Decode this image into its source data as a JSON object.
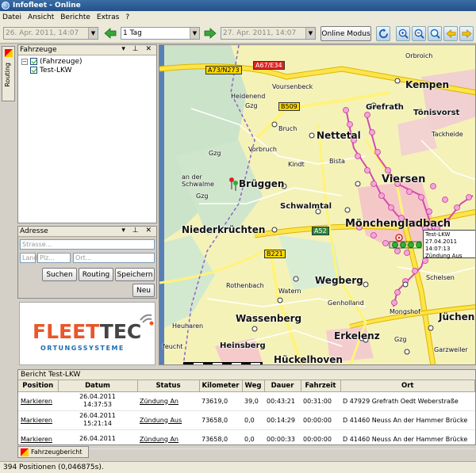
{
  "window": {
    "title": "Infofleet - Online"
  },
  "menu": [
    "Datei",
    "Ansicht",
    "Berichte",
    "Extras",
    "?"
  ],
  "toolbar": {
    "from_date": "26. Apr. 2011, 14:07",
    "period": "1 Tag",
    "to_date": "27. Apr. 2011, 14:07",
    "online_mode": "Online Modus"
  },
  "left_tabs": {
    "routing": "Routing"
  },
  "vehicles_panel": {
    "title": "Fahrzeuge",
    "tree": [
      {
        "label": "(Fahrzeuge)",
        "checked": true,
        "expanded": true
      },
      {
        "label": "Test-LKW",
        "checked": true
      }
    ]
  },
  "address_panel": {
    "title": "Adresse",
    "street_placeholder": "Strasse...",
    "country_placeholder": "Land",
    "zip_placeholder": "Plz...",
    "city_placeholder": "Ort...",
    "buttons": {
      "search": "Suchen",
      "routing": "Routing",
      "save": "Speichern",
      "new": "Neu"
    }
  },
  "logo": {
    "part1": "FLEET",
    "part2": "TEC",
    "subtitle": "ORTUNGSSYSTEME"
  },
  "map": {
    "road_signs": {
      "a67": "A67/E34",
      "a73": "A73/N273",
      "b509": "B509",
      "a52": "A52",
      "b221": "B221"
    },
    "places": {
      "orbroich": "Orbroich",
      "kempen": "Kempen",
      "voursenbeck": "Voursenbeck",
      "heidenend": "Heidenend",
      "gzg1": "Gzg",
      "grefrath": "Grefrath",
      "toenisvorst": "Tönisvorst",
      "bruch": "Bruch",
      "nettetal": "Nettetal",
      "tackheide": "Tackheide",
      "vorbruch": "Vorbruch",
      "kindt": "Kindt",
      "bista": "Bista",
      "gzg2": "Gzg",
      "viersen": "Viersen",
      "schwalme": "an der\nSchwalme",
      "gzg3": "Gzg",
      "brueggen": "Brüggen",
      "schwalmtal": "Schwalmtal",
      "moenchengladbach": "Mönchengladbach",
      "niederkruechten": "Niederkrüchten",
      "rothenbach": "Rothenbach",
      "wegberg": "Wegberg",
      "schelsen": "Schelsen",
      "watern": "Watern",
      "genholland": "Genholland",
      "mongshof": "Mongshof",
      "jüchen": "Jüchen",
      "heuharen": "Heuharen",
      "wassenberg": "Wassenberg",
      "erkelenz": "Erkelenz",
      "gzg4": "Gzg",
      "feucht": "feucht",
      "heinsberg": "Heinsberg",
      "hueckelhoven": "Hückelhoven",
      "garzweiler": "Garzweiler"
    },
    "tooltip": {
      "vehicle": "Test-LKW",
      "time": "27.04.2011 14:07:13",
      "status": "Zündung Aus"
    }
  },
  "report": {
    "title": "Bericht Test-LKW",
    "columns": [
      "Position",
      "Datum",
      "Status",
      "Kilometer",
      "Weg",
      "Dauer",
      "Fahrzeit",
      "Ort"
    ],
    "rows": [
      {
        "position": "Markieren",
        "date": "26.04.2011",
        "time": "14:37:53",
        "status": "Zündung An",
        "km": "73619,0",
        "weg": "39,0",
        "dauer": "00:43:21",
        "fahrzeit": "00:31:00",
        "ort": "D 47929 Grefrath Oedt Weberstraße"
      },
      {
        "position": "Markieren",
        "date": "26.04.2011",
        "time": "15:21:14",
        "status": "Zündung Aus",
        "km": "73658,0",
        "weg": "0,0",
        "dauer": "00:14:29",
        "fahrzeit": "00:00:00",
        "ort": "D 41460 Neuss An der Hammer Brücke"
      },
      {
        "position": "Markieren",
        "date": "26.04.2011",
        "time": "",
        "status": "Zündung An",
        "km": "73658,0",
        "weg": "0,0",
        "dauer": "00:00:33",
        "fahrzeit": "00:00:00",
        "ort": "D 41460 Neuss An der Hammer Brücke"
      }
    ]
  },
  "bottom_tab": {
    "label": "Fahrzeugbericht"
  },
  "status_bar": {
    "text": "394 Positionen (0,046875s)."
  },
  "icons": [
    "app-icon",
    "prev-arrow-icon",
    "next-arrow-icon",
    "refresh-icon",
    "zoom-in-icon",
    "zoom-out-icon",
    "zoom-area-icon",
    "back-icon",
    "forward-icon",
    "checkbox-icon",
    "expand-icon",
    "vehicle-marker-icon",
    "signal-icon",
    "report-icon"
  ],
  "colors": {
    "accent": "#e8572a",
    "route": "#e060c0",
    "title": "#24508a"
  }
}
